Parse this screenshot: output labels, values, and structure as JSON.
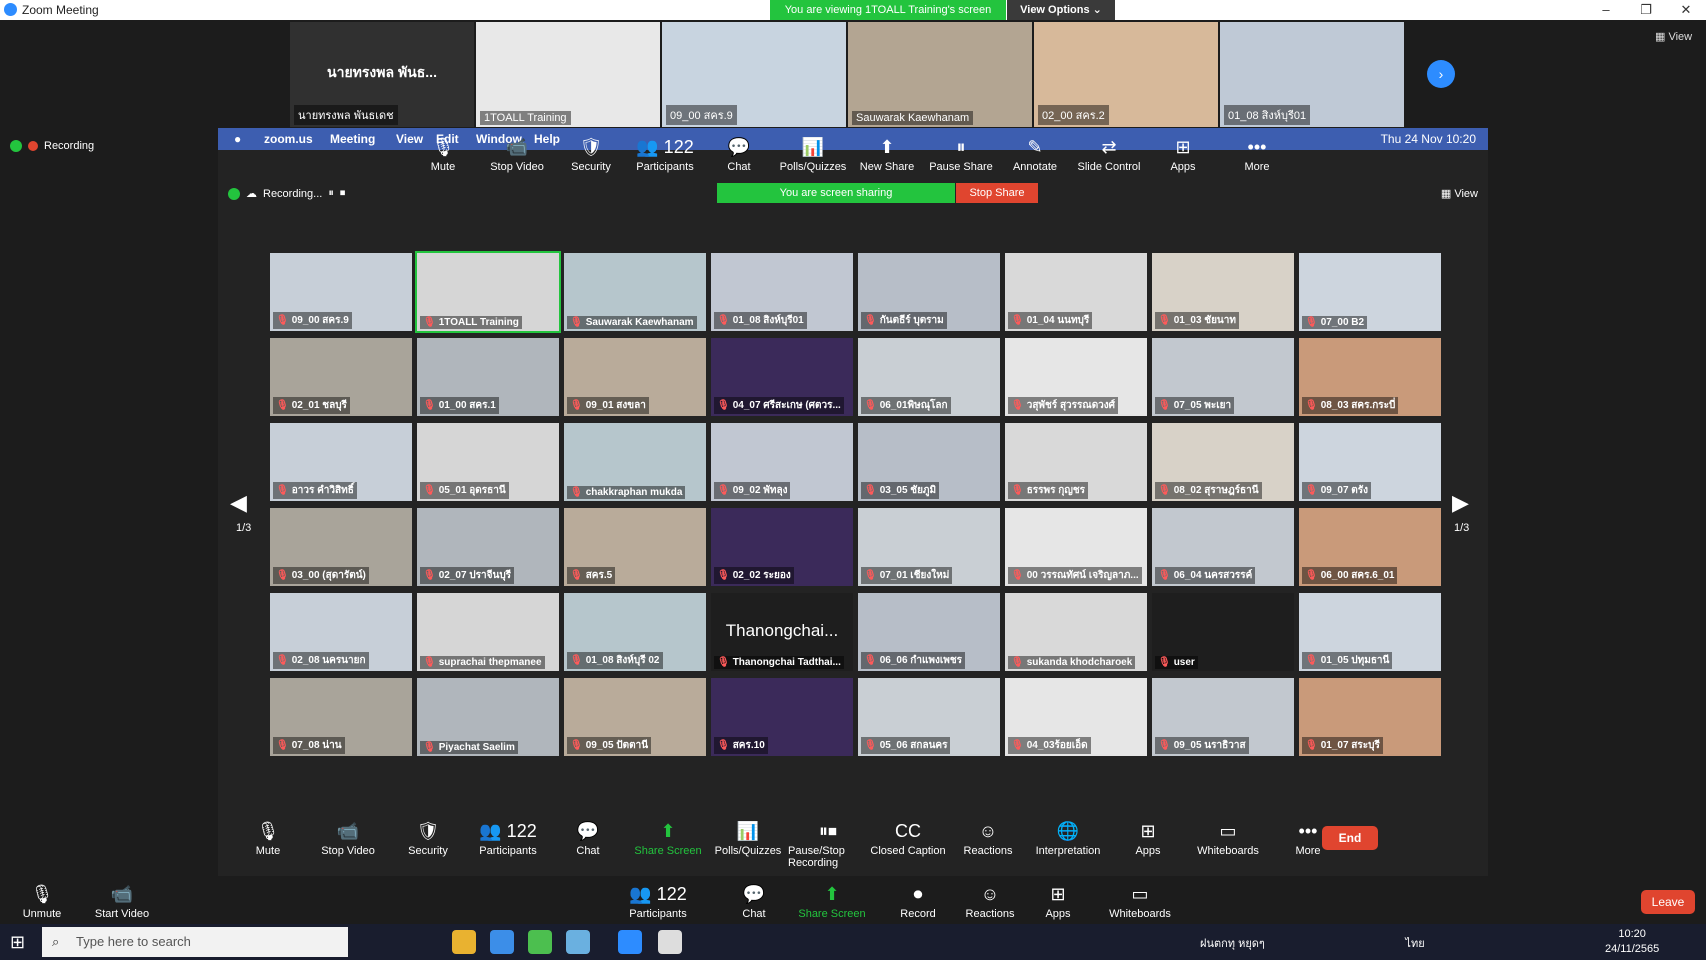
{
  "window": {
    "title": "Zoom Meeting",
    "min": "–",
    "max": "❐",
    "close": "✕"
  },
  "banner": {
    "viewing": "You are viewing 1TOALL Training's screen",
    "view_options": "View Options ⌄",
    "view": "View"
  },
  "outer_strip": [
    {
      "name": "นายทรงพล พันธเดช",
      "big": "นายทรงพล พันธ...",
      "bg": "#303030"
    },
    {
      "name": "1TOALL Training",
      "big": "",
      "bg": "#e8e8e8"
    },
    {
      "name": "09_00 สคร.9",
      "big": "",
      "bg": "#c8d4e0"
    },
    {
      "name": "Sauwarak Kaewhanam",
      "big": "",
      "bg": "#b3a592"
    },
    {
      "name": "02_00 สคร.2",
      "big": "",
      "bg": "#d7b99a"
    },
    {
      "name": "01_08 สิงห์บุรี01",
      "big": "",
      "bg": "#bfc9d6"
    }
  ],
  "outer_recording": "Recording",
  "mac_menu": {
    "app": "zoom.us",
    "items": [
      "Meeting",
      "View",
      "Edit",
      "Window",
      "Help"
    ],
    "clock": "Thu 24 Nov  10:20"
  },
  "share_toolbar": [
    {
      "label": "Mute",
      "icon": "🎙"
    },
    {
      "label": "Stop Video",
      "icon": "📹"
    },
    {
      "label": "Security",
      "icon": "🛡"
    },
    {
      "label": "Participants",
      "icon": "👥 122"
    },
    {
      "label": "Chat",
      "icon": "💬"
    },
    {
      "label": "Polls/Quizzes",
      "icon": "📊"
    },
    {
      "label": "New Share",
      "icon": "⬆"
    },
    {
      "label": "Pause Share",
      "icon": "⏸"
    },
    {
      "label": "Annotate",
      "icon": "✎"
    },
    {
      "label": "Slide Control",
      "icon": "⇄"
    },
    {
      "label": "Apps",
      "icon": "⊞"
    },
    {
      "label": "More",
      "icon": "•••"
    }
  ],
  "inner_top": {
    "recording": "Recording...",
    "sharing": "You are screen sharing",
    "stop_share": "Stop Share",
    "view": "View"
  },
  "grid": [
    "09_00 สคร.9",
    "1TOALL Training",
    "Sauwarak Kaewhanam",
    "01_08 สิงห์บุรี01",
    "กันตธีร์ บุตราม",
    "01_04 นนทบุรี",
    "01_03 ชัยนาท",
    "07_00 B2",
    "02_01 ชลบุรี",
    "01_00 สคร.1",
    "09_01 สงขลา",
    "04_07 ศรีสะเกษ (ศตวร...",
    "06_01พิษณุโลก",
    "วสุพัชร์ สุวรรณดวงศ์",
    "07_05 พะเยา",
    "08_03 สคร.กระบี่",
    "อาวร คำวิสิทธิ์",
    "05_01 อุดรธานี",
    "chakkraphan mukda",
    "09_02 พัทลุง",
    "03_05 ชัยภูมิ",
    "ธรรพร กุญชร",
    "08_02 สุราษฎร์ธานี",
    "09_07 ตรัง",
    "03_00 (สุดารัตน์)",
    "02_07 ปราจีนบุรี",
    "สคร.5",
    "02_02 ระยอง",
    "07_01 เชียงใหม่",
    "00 วรรณทัศน์ เจริญลาภ...",
    "06_04 นครสวรรค์",
    "06_00 สคร.6_01",
    "02_08 นครนายก",
    "suprachai thepmanee",
    "01_08 สิงห์บุรี 02",
    "Thanongchai Tadthai...",
    "06_06 กำแพงเพชร",
    "sukanda khodcharoek",
    "user",
    "01_05 ปทุมธานี",
    "07_08 น่าน",
    "Piyachat Saelim",
    "09_05 ปัตตานี",
    "สคร.10",
    "05_06 สกลนคร",
    "04_03ร้อยเอ็ด",
    "09_05 นราธิวาส",
    "01_07 สระบุรี"
  ],
  "grid_big": {
    "35": "Thanongchai..."
  },
  "pager": {
    "left": "1/3",
    "right": "1/3"
  },
  "meeting_toolbar": [
    {
      "label": "Mute",
      "icon": "🎙"
    },
    {
      "label": "Stop Video",
      "icon": "📹"
    },
    {
      "label": "Security",
      "icon": "🛡"
    },
    {
      "label": "Participants",
      "icon": "👥 122"
    },
    {
      "label": "Chat",
      "icon": "💬"
    },
    {
      "label": "Share Screen",
      "icon": "⬆"
    },
    {
      "label": "Polls/Quizzes",
      "icon": "📊"
    },
    {
      "label": "Pause/Stop Recording",
      "icon": "⏸⏹"
    },
    {
      "label": "Closed Caption",
      "icon": "CC"
    },
    {
      "label": "Reactions",
      "icon": "☺"
    },
    {
      "label": "Interpretation",
      "icon": "🌐"
    },
    {
      "label": "Apps",
      "icon": "⊞"
    },
    {
      "label": "Whiteboards",
      "icon": "▭"
    },
    {
      "label": "More",
      "icon": "•••"
    }
  ],
  "end_label": "End",
  "outer_toolbar": [
    {
      "label": "Unmute",
      "icon": "🎙"
    },
    {
      "label": "Start Video",
      "icon": "📹"
    },
    {
      "label": "Participants",
      "icon": "👥 122"
    },
    {
      "label": "Chat",
      "icon": "💬"
    },
    {
      "label": "Share Screen",
      "icon": "⬆"
    },
    {
      "label": "Record",
      "icon": "⏺"
    },
    {
      "label": "Reactions",
      "icon": "☺"
    },
    {
      "label": "Apps",
      "icon": "⊞"
    },
    {
      "label": "Whiteboards",
      "icon": "▭"
    }
  ],
  "leave_label": "Leave",
  "taskbar": {
    "search_placeholder": "Type here to search",
    "tray": "ฝนตกทุ หยุดๆ",
    "lang": "ไทย",
    "time": "10:20",
    "date": "24/11/2565"
  },
  "colors": {
    "accent": "#2d8cff",
    "green": "#23c43e",
    "red": "#e0452f"
  }
}
